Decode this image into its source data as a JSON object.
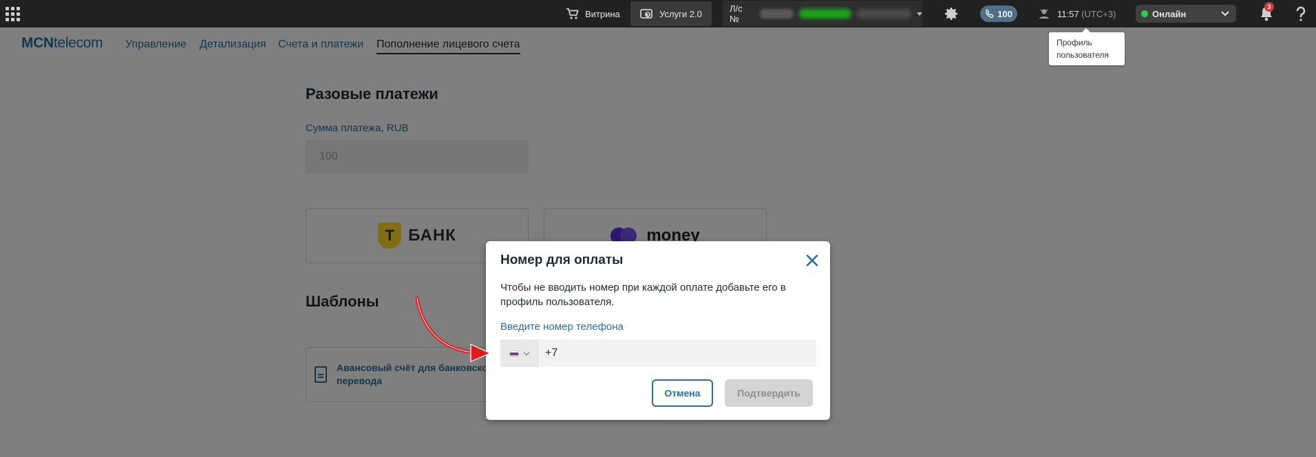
{
  "topbar": {
    "vitrina": "Витрина",
    "uslugi": "Услуги 2.0",
    "account_prefix": "Л/с №",
    "calls": "100",
    "time": "11:57",
    "tz": "(UTC+3)",
    "status": "Онлайн",
    "notifications": "3"
  },
  "tooltip": {
    "text": "Профиль пользователя"
  },
  "nav": {
    "logo_bold": "MCN",
    "logo_rest": "telecom",
    "items": [
      "Управление",
      "Детализация",
      "Счета и платежи",
      "Пополнение лицевого счета"
    ]
  },
  "page": {
    "one_time_title": "Разовые платежи",
    "amount_label": "Сумма платежа, RUB",
    "amount_placeholder": "100",
    "bank_tbank_letter": "Т",
    "bank_tbank_name": "БАНК",
    "bank_yoo_name": "money",
    "templates_title": "Шаблоны",
    "template_item": "Авансовый счёт для банковского перевода"
  },
  "modal": {
    "title": "Номер для оплаты",
    "description": "Чтобы не вводить номер при каждой оплате добавьте его в профиль пользователя.",
    "phone_label": "Введите номер телефона",
    "phone_value": "+7",
    "cancel": "Отмена",
    "confirm": "Подтвердить"
  },
  "colors": {
    "accent": "#2a6f9a",
    "topbar": "#212121",
    "online": "#2bd248",
    "badge": "#d03b3b",
    "annotation_arrow": "#e01b1b"
  }
}
